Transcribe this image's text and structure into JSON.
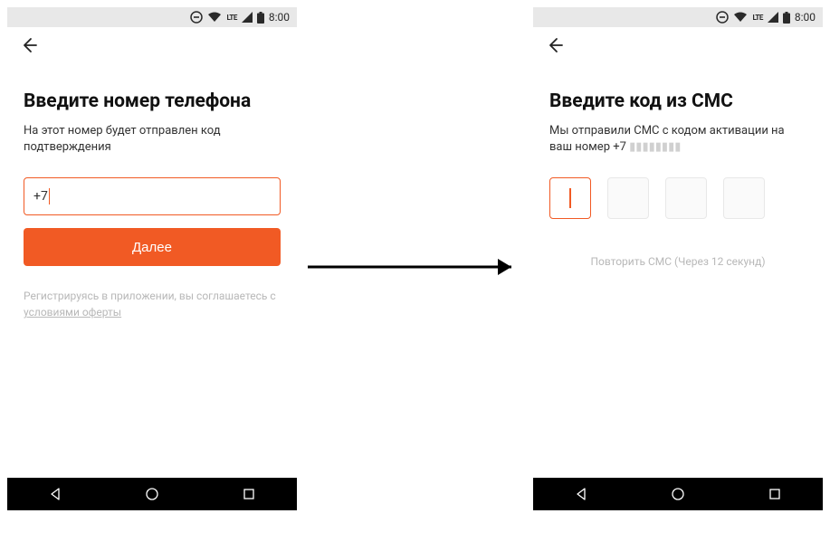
{
  "statusbar": {
    "network": "LTE",
    "battery": 100,
    "time": "8:00"
  },
  "left": {
    "heading": "Введите номер телефона",
    "subtext": "На этот номер будет отправлен код подтверждения",
    "phone_prefix": "+7",
    "next_button": "Далее",
    "agree_prefix": "Регистрируясь в приложении, вы соглашаетесь с ",
    "agree_link": "условиями оферты"
  },
  "right": {
    "heading": "Введите код из СМС",
    "subtext_prefix": "Мы отправили СМС с кодом активации на ваш номер ",
    "phone_display": "+7",
    "resend": "Повторить СМС (Через 12 секунд)"
  }
}
